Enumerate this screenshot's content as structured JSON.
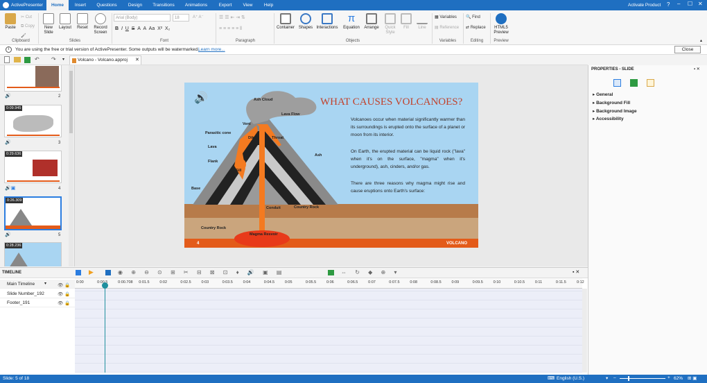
{
  "app": {
    "name": "ActivePresenter",
    "activate": "Activate Product"
  },
  "tabs": [
    "Home",
    "Insert",
    "Questions",
    "Design",
    "Transitions",
    "Animations",
    "Export",
    "View",
    "Help"
  ],
  "ribbon": {
    "clipboard": {
      "paste": "Paste",
      "cut": "Cut",
      "copy": "Copy",
      "group": "Clipboard"
    },
    "slides": {
      "new_slide": "New Slide",
      "layout": "Layout",
      "reset": "Reset",
      "record_screen": "Record Screen",
      "group": "Slides"
    },
    "font": {
      "family": "Arial (Body)",
      "size": "18",
      "group": "Font"
    },
    "paragraph": {
      "group": "Paragraph"
    },
    "objects": {
      "container": "Container",
      "shapes": "Shapes",
      "interactions": "Interactions",
      "equation": "Equation",
      "arrange": "Arrange",
      "quick_style": "Quick Style",
      "fill": "Fill",
      "line": "Line",
      "group": "Objects"
    },
    "variables": {
      "variables": "Variables",
      "reference": "Reference",
      "group": "Variables"
    },
    "editing": {
      "find": "Find",
      "replace": "Replace",
      "group": "Editing"
    },
    "preview": {
      "html5": "HTML5 Preview",
      "group": "Preview"
    }
  },
  "notice": {
    "text": "You are using the free or trial version of ActivePresenter. Some outputs will be watermarked.",
    "link": "Learn more...",
    "close": "Close"
  },
  "doc_tab": "Volcano - Volcano.approj",
  "thumbnails": [
    {
      "num": "2",
      "dur": ""
    },
    {
      "num": "3",
      "dur": "0:09.945"
    },
    {
      "num": "4",
      "dur": "0:29.636"
    },
    {
      "num": "5",
      "dur": "0:26.309"
    },
    {
      "num": "",
      "dur": "0:28.236"
    }
  ],
  "slide": {
    "title": "WHAT CAUSES VOLCANOES?",
    "p1": "Volcanoes occur when material significantly warmer than its surroundings is erupted onto the surface of a planet or moon from its interior.",
    "p2": "On Earth, the erupted material can be liquid rock (\"lava\" when it's on the surface, \"magma\" when it's underground), ash, cinders, and/or gas.",
    "p3": "There are three reasons why magma might rise and cause eruptions onto Earth's surface:",
    "labels": {
      "ash_cloud": "Ash Cloud",
      "lava_flow": "Lava Flow",
      "vent": "Vent",
      "parasitic": "Parasitic cone",
      "dike": "Dike",
      "throat": "Throat",
      "lava": "Lava",
      "flank": "Flank",
      "sill": "Sill",
      "ash": "Ash",
      "base": "Base",
      "conduit": "Conduit",
      "country_rock1": "Country Rock",
      "country_rock2": "Country Rock",
      "magma": "Magma Resvoir"
    },
    "footer_num": "4",
    "footer_text": "VOLCANO"
  },
  "properties": {
    "title": "PROPERTIES - SLIDE",
    "items": [
      "General",
      "Background Fill",
      "Background Image",
      "Accessibility"
    ]
  },
  "timeline": {
    "title": "TIMELINE",
    "tracks": [
      "Main Timeline",
      "Slide Number_192",
      "Footer_191"
    ],
    "ticks": [
      "0:00",
      "0:00.5",
      "0:00.708",
      "0:01.5",
      "0:02",
      "0:02.5",
      "0:03",
      "0:03.5",
      "0:04",
      "0:04.5",
      "0:05",
      "0:05.5",
      "0:06",
      "0:06.5",
      "0:07",
      "0:07.5",
      "0:08",
      "0:08.5",
      "0:09",
      "0:09.5",
      "0:10",
      "0:10.5",
      "0:11",
      "0:11.5",
      "0:12"
    ]
  },
  "status": {
    "slide": "Slide: 5 of 18",
    "lang": "English (U.S.)",
    "zoom": "62%"
  }
}
